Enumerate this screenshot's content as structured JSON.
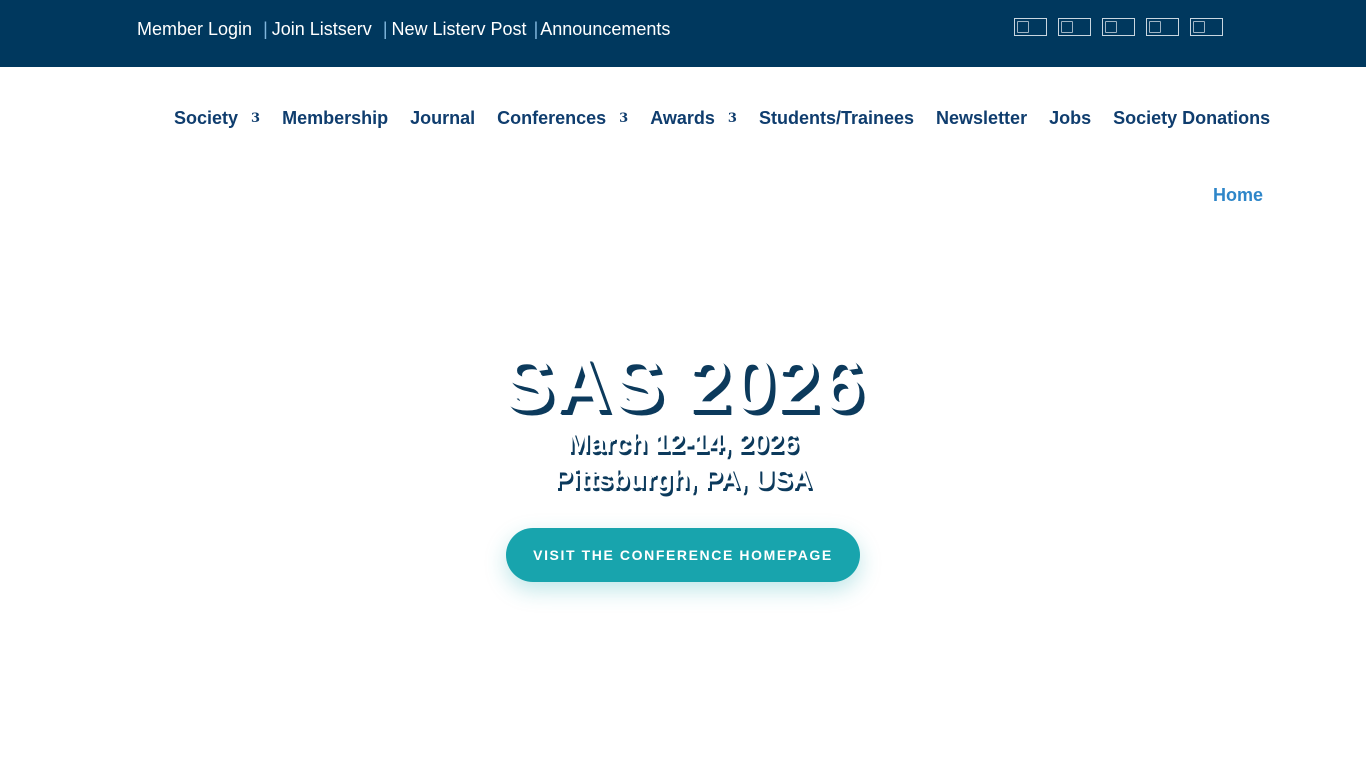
{
  "topbar": {
    "links": [
      {
        "label": "Member Login"
      },
      {
        "label": "Join Listserv"
      },
      {
        "label": "New Listerv Post"
      },
      {
        "label": "Announcements"
      }
    ],
    "separator": "|",
    "social_icons": [
      "social-icon-1",
      "social-icon-2",
      "social-icon-3",
      "social-icon-4",
      "social-icon-5"
    ],
    "background_color": "#00385e"
  },
  "nav": {
    "items": [
      {
        "label": "Society",
        "arrow": "3"
      },
      {
        "label": "Membership"
      },
      {
        "label": "Journal"
      },
      {
        "label": "Conferences",
        "arrow": "3"
      },
      {
        "label": "Awards",
        "arrow": "3"
      },
      {
        "label": "Students/Trainees"
      },
      {
        "label": "Newsletter"
      },
      {
        "label": "Jobs"
      },
      {
        "label": "Society Donations"
      }
    ],
    "color": "#0f3d6e"
  },
  "breadcrumb": {
    "home": "Home"
  },
  "hero": {
    "title": "SAS 2026",
    "date": "March 12-14, 2026",
    "location": "Pittsburgh, PA, USA",
    "cta_label": "VISIT THE CONFERENCE HOMEPAGE",
    "cta_color": "#18a4ad"
  }
}
